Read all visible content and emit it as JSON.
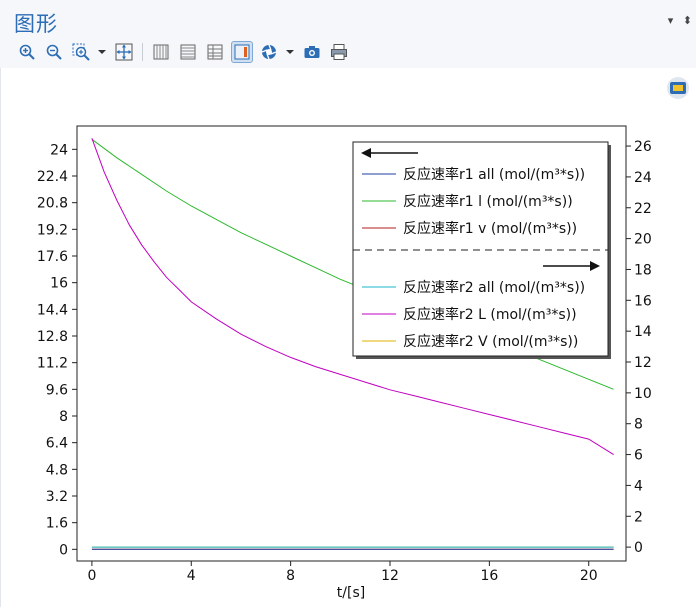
{
  "panel": {
    "title": "图形",
    "controls": [
      "▾",
      "⬍"
    ]
  },
  "toolbar": {
    "icons": [
      "zoom-in-icon",
      "zoom-out-icon",
      "zoom-box-icon",
      "dropdown-icon",
      "zoom-extents-icon",
      "grid-icon",
      "horizontal-lines-icon",
      "table-icon",
      "legend-icon",
      "scene-light-icon",
      "dropdown-icon",
      "camera-icon",
      "print-icon"
    ]
  },
  "colors": {
    "title": "#2d6db5",
    "r1_all": "#1f3fa6",
    "r1_l": "#2db82d",
    "r1_v": "#b01e1e",
    "r2_all": "#1ab6c8",
    "r2_L": "#c000c0",
    "r2_V": "#e0b000"
  },
  "chart_data": {
    "type": "line",
    "xlabel": "t/[s]",
    "xlim": [
      -0.6,
      21.5
    ],
    "x_ticks": [
      "0",
      "4",
      "8",
      "12",
      "16",
      "20"
    ],
    "x_tick_values": [
      0,
      4,
      8,
      12,
      16,
      20
    ],
    "y_left": {
      "ylim": [
        -0.7,
        25.4
      ],
      "ticks": [
        "0",
        "1.6",
        "3.2",
        "4.8",
        "6.4",
        "8",
        "9.6",
        "11.2",
        "12.8",
        "14.4",
        "16",
        "17.6",
        "19.2",
        "20.8",
        "22.4",
        "24"
      ],
      "tick_values": [
        0,
        1.6,
        3.2,
        4.8,
        6.4,
        8,
        9.6,
        11.2,
        12.8,
        14.4,
        16,
        17.6,
        19.2,
        20.8,
        22.4,
        24
      ]
    },
    "y_right": {
      "ylim": [
        -0.9,
        27.3
      ],
      "ticks": [
        "0",
        "2",
        "4",
        "6",
        "8",
        "10",
        "12",
        "14",
        "16",
        "18",
        "20",
        "22",
        "24",
        "26"
      ],
      "tick_values": [
        0,
        2,
        4,
        6,
        8,
        10,
        12,
        14,
        16,
        18,
        20,
        22,
        24,
        26
      ]
    },
    "legend_arrows": [
      "left",
      "right"
    ],
    "series": [
      {
        "name": "反应速率r1 all (mol/(m³*s))",
        "axis": "left",
        "color_key": "r1_all",
        "x": [
          0,
          21
        ],
        "y": [
          0,
          0
        ]
      },
      {
        "name": "反应速率r1 l (mol/(m³*s))",
        "axis": "left",
        "color_key": "r1_l",
        "x": [
          0,
          1,
          2,
          3,
          4,
          5,
          6,
          7,
          8,
          9,
          10,
          11,
          12,
          13,
          14,
          15,
          16,
          17,
          18,
          19,
          20,
          21
        ],
        "y": [
          24.6,
          23.5,
          22.5,
          21.5,
          20.6,
          19.8,
          19.0,
          18.3,
          17.6,
          16.9,
          16.2,
          15.6,
          15.0,
          14.4,
          13.8,
          13.2,
          12.6,
          12.0,
          11.4,
          10.8,
          10.2,
          9.6
        ]
      },
      {
        "name": "反应速率r1 v (mol/(m³*s))",
        "axis": "left",
        "color_key": "r1_v",
        "x": [
          0,
          21
        ],
        "y": [
          0,
          0
        ]
      },
      {
        "name": "反应速率r2 all (mol/(m³*s))",
        "axis": "right",
        "color_key": "r2_all",
        "x": [
          0,
          21
        ],
        "y": [
          0,
          0
        ]
      },
      {
        "name": "反应速率r2 L (mol/(m³*s))",
        "axis": "right",
        "color_key": "r2_L",
        "x": [
          0,
          0.5,
          1,
          1.5,
          2,
          2.5,
          3,
          3.5,
          4,
          5,
          6,
          7,
          8,
          9,
          10,
          11,
          12,
          13,
          14,
          15,
          16,
          17,
          18,
          19,
          20,
          21
        ],
        "y": [
          26.5,
          24.3,
          22.5,
          20.9,
          19.6,
          18.5,
          17.5,
          16.7,
          15.9,
          14.8,
          13.8,
          13.0,
          12.3,
          11.7,
          11.2,
          10.7,
          10.2,
          9.8,
          9.4,
          9.0,
          8.6,
          8.2,
          7.8,
          7.4,
          7.0,
          6.0
        ]
      },
      {
        "name": "反应速率r2 V (mol/(m³*s))",
        "axis": "right",
        "color_key": "r2_V",
        "x": [
          0,
          21
        ],
        "y": [
          0,
          0
        ]
      }
    ]
  }
}
